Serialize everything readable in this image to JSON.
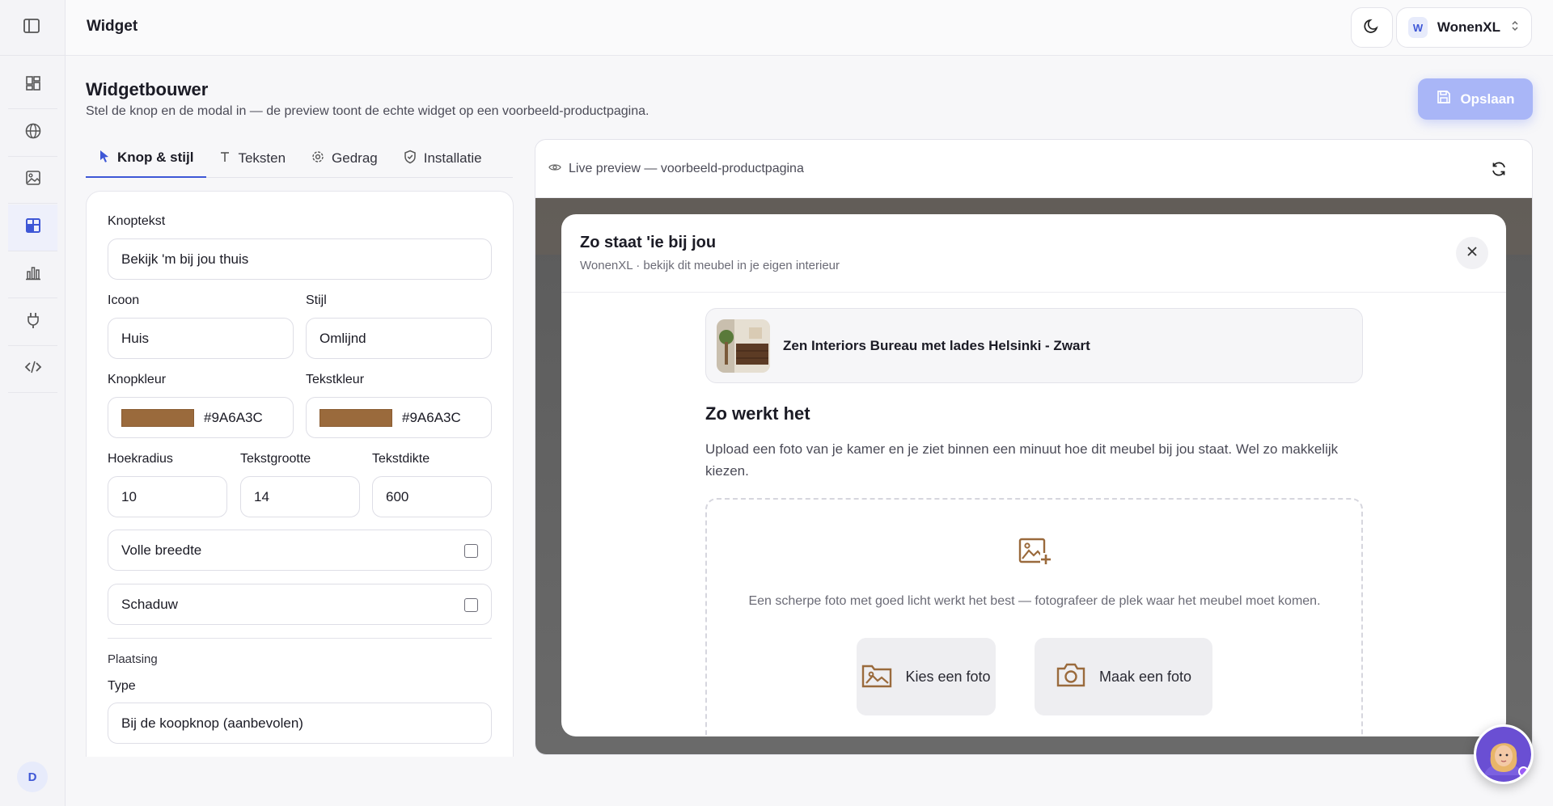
{
  "topbar": {
    "title": "Widget",
    "org_initial": "W",
    "org_name": "WonenXL"
  },
  "rail": {
    "user_initial": "D"
  },
  "header": {
    "title": "Widgetbouwer",
    "subtitle": "Stel de knop en de modal in — de preview toont de echte widget op een voorbeeld-productpagina.",
    "save_label": "Opslaan"
  },
  "tabs": [
    {
      "label": "Knop & stijl"
    },
    {
      "label": "Teksten"
    },
    {
      "label": "Gedrag"
    },
    {
      "label": "Installatie"
    }
  ],
  "form": {
    "button_text_label": "Knoptekst",
    "button_text_value": "Bekijk 'm bij jou thuis",
    "icon_label": "Icoon",
    "icon_value": "Huis",
    "style_label": "Stijl",
    "style_value": "Omlijnd",
    "button_color_label": "Knopkleur",
    "button_color_value": "#9A6A3C",
    "text_color_label": "Tekstkleur",
    "text_color_value": "#9A6A3C",
    "radius_label": "Hoekradius",
    "radius_value": "10",
    "font_size_label": "Tekstgrootte",
    "font_size_value": "14",
    "font_weight_label": "Tekstdikte",
    "font_weight_value": "600",
    "full_width_label": "Volle breedte",
    "shadow_label": "Schaduw",
    "placement_heading": "Plaatsing",
    "type_label": "Type",
    "type_value": "Bij de koopknop (aanbevolen)"
  },
  "preview": {
    "header_label": "Live preview — voorbeeld-productpagina",
    "modal_title": "Zo staat 'ie bij jou",
    "modal_subtitle": "WonenXL · bekijk dit meubel in je eigen interieur",
    "product_name": "Zen Interiors Bureau met lades Helsinki - Zwart",
    "how_title": "Zo werkt het",
    "how_text": "Upload een foto van je kamer en je ziet binnen een minuut hoe dit meubel bij jou staat. Wel zo makkelijk kiezen.",
    "drop_hint": "Een scherpe foto met goed licht werkt het best — fotografeer de plek waar het meubel moet komen.",
    "choose_photo": "Kies een foto",
    "take_photo": "Maak een foto"
  },
  "colors": {
    "accent": "#3e57d6",
    "brand": "#9A6A3C",
    "save_bg": "#a9b6f7"
  }
}
